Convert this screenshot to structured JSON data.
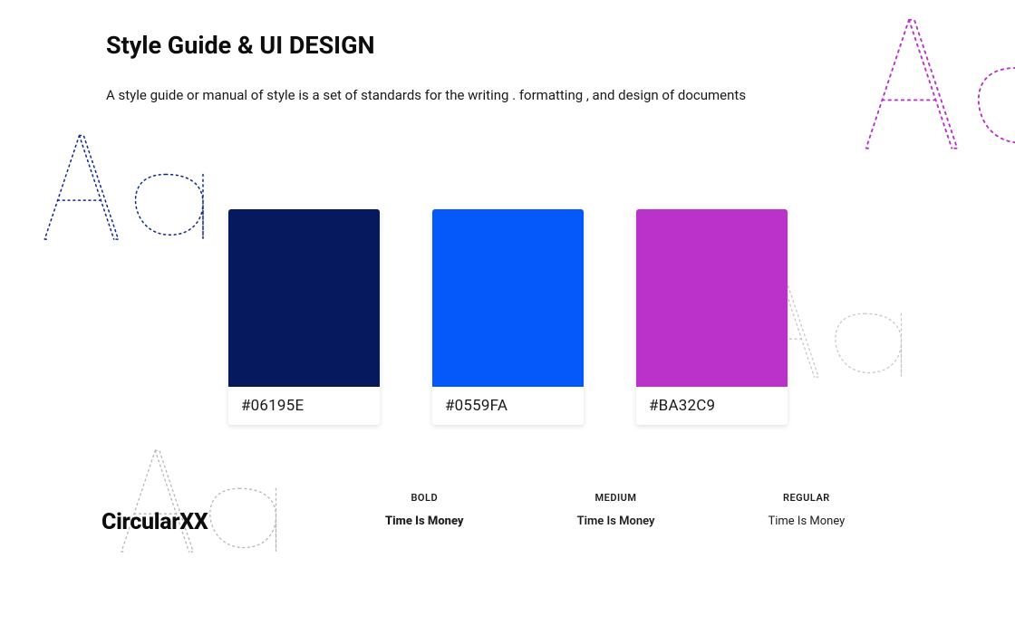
{
  "header": {
    "title": "Style Guide & UI DESIGN",
    "subtitle": "A style guide or manual of style is a set of standards for the writing . formatting , and design of documents"
  },
  "swatches": [
    {
      "hex": "#06195E"
    },
    {
      "hex": "#0559FA"
    },
    {
      "hex": "#BA32C9"
    }
  ],
  "font": {
    "name": "CircularXX",
    "weights": [
      {
        "label": "BOLD",
        "sample": "Time Is Money"
      },
      {
        "label": "MEDIUM",
        "sample": "Time Is Money"
      },
      {
        "label": "REGULAR",
        "sample": "Time Is Money"
      }
    ]
  },
  "decor_colors": {
    "aa1": "#102B8E",
    "aa2": "#B7B7B7",
    "aa3": "#C8C8C8",
    "aa4": "#BA32C9"
  }
}
